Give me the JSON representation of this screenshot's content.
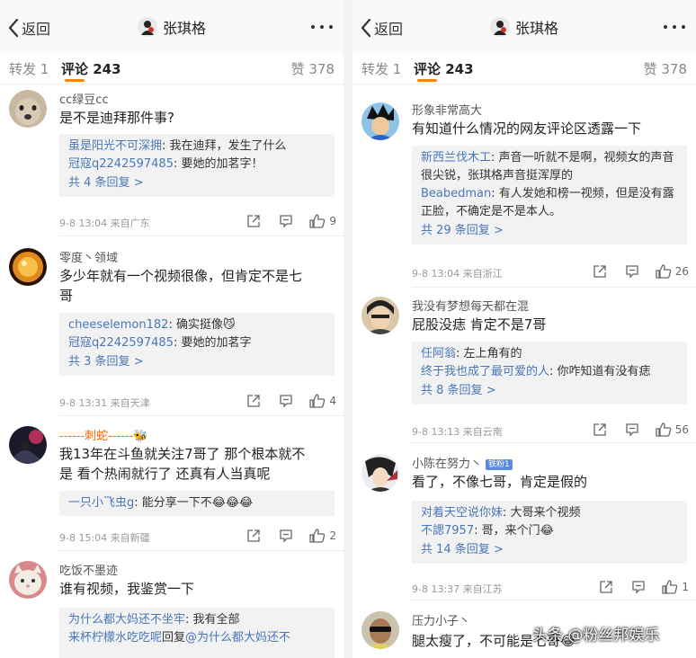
{
  "watermark": "头条 @粉丝邦娱乐",
  "left": {
    "header": {
      "back": "返回",
      "title": "张琪格"
    },
    "tabs": {
      "repost": "转发 1",
      "comment": "评论 243",
      "like": "赞 378"
    },
    "comments": [
      {
        "user": "cc绿豆cc",
        "text_lines": [
          "是不是迪拜那件事?"
        ],
        "replies": [
          {
            "name": "虽是阳光不可深拥",
            "text": ": 我在迪拜，发生了什么"
          },
          {
            "name": "冠寇q2242597485",
            "text": ": 要她的加茗字！"
          }
        ],
        "more": "共 4 条回复 >",
        "time": "9-8 13:04",
        "source": "来自广东",
        "likes": "9"
      },
      {
        "user": "零度丶领域",
        "text_lines": [
          "多少年就有一个视频很像，但肯定不是七",
          "哥"
        ],
        "replies": [
          {
            "name": "cheeselemon182",
            "text": ": 确实挺像😼"
          },
          {
            "name": "冠寇q2242597485",
            "text": ": 要她的加茗字"
          }
        ],
        "more": "共 3 条回复 >",
        "time": "9-8 13:31",
        "source": "来自天津",
        "likes": "4"
      },
      {
        "user": "------刺蛇------🐝",
        "text_lines": [
          "我13年在斗鱼就关注7哥了 那个根本就不",
          "是 看个热闹就行了 还真有人当真呢"
        ],
        "replies": [
          {
            "name": "一只小飞虫g",
            "text": ": 能分享一下不😂😂😂"
          }
        ],
        "time": "9-8 15:04",
        "source": "来自新疆",
        "likes": "2"
      },
      {
        "user": "吃饭不墨迹",
        "text_lines": [
          "谁有视频，我鉴赏一下"
        ],
        "replies": [
          {
            "name": "为什么都大妈还不坐牢",
            "text": ": 我有全部"
          },
          {
            "name": "来杯柠檬水吃吃呢",
            "mid": "回复",
            "name2": "@为什么都大妈还不",
            "text": ""
          }
        ]
      }
    ]
  },
  "right": {
    "header": {
      "back": "返回",
      "title": "张琪格"
    },
    "tabs": {
      "repost": "转发 1",
      "comment": "评论 243",
      "like": "赞 378"
    },
    "comments": [
      {
        "user": "形象非常高大",
        "text_lines": [
          "有知道什么情况的网友评论区透露一下"
        ],
        "replies": [
          {
            "name": "新西兰伐木工",
            "text": ": 声音一听就不是啊，视频女的声音很尖锐，张琪格声音挺浑厚的"
          },
          {
            "name": "Beabedman",
            "text": ": 有人发她和榜一视频，但是没有露正脸，不确定是不是本人。"
          }
        ],
        "more": "共 29 条回复 >",
        "time": "9-8 13:04",
        "source": "来自浙江",
        "likes": "26"
      },
      {
        "user": "我没有梦想每天都在混",
        "text_lines": [
          "屁股没痣 肯定不是7哥"
        ],
        "replies": [
          {
            "name": "任阿翁",
            "text": ": 左上角有的"
          },
          {
            "name": "终于我也成了最可爱的人",
            "text": ": 你咋知道有没有痣"
          }
        ],
        "more": "共 8 条回复 >",
        "time": "9-8 13:13",
        "source": "来自云南",
        "likes": "56"
      },
      {
        "user": "小陈在努力丶",
        "badge": "铁粉1",
        "text_lines": [
          "看了，不像七哥，肯定是假的"
        ],
        "replies": [
          {
            "name": "对着天空说你妹",
            "text": ": 大哥来个视频"
          },
          {
            "name": "不諰7957",
            "text": ": 哥，来个门😂"
          }
        ],
        "more": "共 14 条回复 >",
        "time": "9-8 13:37",
        "source": "来自江苏",
        "likes": "1"
      },
      {
        "user": "压力小子丶",
        "text_lines": [
          "腿太瘦了，不可能是七哥😂"
        ]
      }
    ]
  },
  "colors": {
    "accent": "#ff8200",
    "link": "#4877b8",
    "reply_bg": "#f2f2f2"
  },
  "icons": [
    "back-arrow-icon",
    "more-dots-icon",
    "share-icon",
    "reply-icon",
    "thumbs-up-icon"
  ]
}
